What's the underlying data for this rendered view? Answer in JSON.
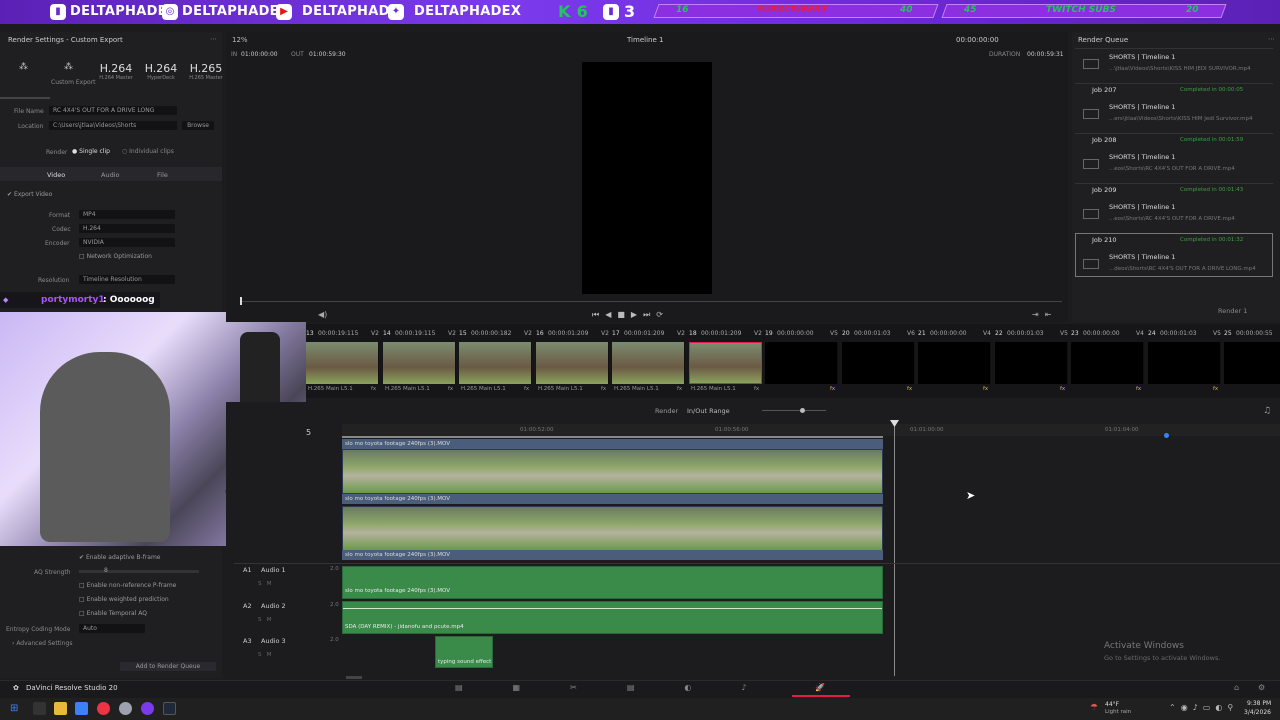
{
  "banner": {
    "handles": [
      "DELTAPHADE",
      "DELTAPHADE",
      "DELTAPHADE",
      "DELTAPHADEX"
    ],
    "k_label": "K 6",
    "k_count": "3",
    "subs_current": "16",
    "subs_label": "SUBSCRIBERS",
    "subs_goal": "40",
    "twitch_current": "45",
    "twitch_label": "TWITCH SUBS",
    "twitch_goal": "20",
    "colors": {
      "accent": "#7c3aed",
      "green": "#22c55e"
    }
  },
  "render_settings": {
    "title": "Render Settings - Custom Export",
    "presets": [
      {
        "name": "",
        "sub": "Custom Export"
      },
      {
        "name": "H.264",
        "sub": "H.264 Master"
      },
      {
        "name": "H.264",
        "sub": "HyperDeck"
      },
      {
        "name": "H.265",
        "sub": "H.265 Master"
      }
    ],
    "file_name_label": "File Name",
    "file_name": "RC 4X4'S OUT FOR A DRIVE LONG",
    "location_label": "Location",
    "location": "C:\\Users\\jtlaa\\Videos\\Shorts",
    "browse": "Browse",
    "render_label": "Render",
    "single_clip": "Single clip",
    "individual_clips": "Individual clips",
    "tabs": [
      "Video",
      "Audio",
      "File"
    ],
    "export_video": "Export Video",
    "format_label": "Format",
    "format": "MP4",
    "codec_label": "Codec",
    "codec": "H.264",
    "encoder_label": "Encoder",
    "encoder": "NVIDIA",
    "network_opt": "Network Optimization",
    "resolution_label": "Resolution",
    "resolution": "Timeline Resolution",
    "adaptive_bframe": "Enable adaptive B-frame",
    "aq_label": "AQ Strength",
    "aq_value": "8",
    "nonref_pframe": "Enable non-reference P-frame",
    "weighted_pred": "Enable weighted prediction",
    "temporal_aq": "Enable Temporal AQ",
    "entropy_label": "Entropy Coding Mode",
    "entropy_value": "Auto",
    "advanced": "Advanced Settings",
    "add_queue": "Add to Render Queue"
  },
  "chat": {
    "user": "portymorty1",
    "message": ": Oooooog"
  },
  "viewer": {
    "zoom": "12%",
    "timeline": "Timeline 1",
    "timecode": "00:00:00:00",
    "in_label": "IN",
    "in_tc": "01:00:00:00",
    "out_label": "OUT",
    "out_tc": "01:00:59:30",
    "duration_label": "DURATION",
    "duration_tc": "00:00:59:31"
  },
  "render_queue": {
    "title": "Render Queue",
    "jobs": [
      {
        "id": "",
        "name": "SHORTS | Timeline 1",
        "path": "...\\jtlaa\\Videos\\Shorts\\KISS HIM JEDI SURVIVOR.mp4",
        "status": ""
      },
      {
        "id": "Job 207",
        "name": "SHORTS | Timeline 1",
        "path": "...ers\\jtlaa\\Videos\\Shorts\\KISS HIM Jedi Survivor.mp4",
        "status": "Completed in 00:00:05"
      },
      {
        "id": "Job 208",
        "name": "SHORTS | Timeline 1",
        "path": "...eos\\Shorts\\RC 4X4'S OUT FOR A DRIVE.mp4",
        "status": "Completed in 00:01:59"
      },
      {
        "id": "Job 209",
        "name": "SHORTS | Timeline 1",
        "path": "...eos\\Shorts\\RC 4X4'S OUT FOR A DRIVE.mp4",
        "status": "Completed in 00:01:43"
      },
      {
        "id": "Job 210",
        "name": "SHORTS | Timeline 1",
        "path": "...deos\\Shorts\\RC 4X4'S OUT FOR A DRIVE LONG.mp4",
        "status": "Completed in 00:01:32"
      }
    ],
    "render_button": "Render 1"
  },
  "clips": [
    {
      "num": "13",
      "tc": "00:00:19:115",
      "track": "V2",
      "label": "H.265 Main L5.1"
    },
    {
      "num": "14",
      "tc": "00:00:19:115",
      "track": "V2",
      "label": "H.265 Main L5.1"
    },
    {
      "num": "15",
      "tc": "00:00:00:182",
      "track": "V2",
      "label": "H.265 Main L5.1"
    },
    {
      "num": "16",
      "tc": "00:00:01:209",
      "track": "V2",
      "label": "H.265 Main L5.1"
    },
    {
      "num": "17",
      "tc": "00:00:01:209",
      "track": "V2",
      "label": "H.265 Main L5.1"
    },
    {
      "num": "18",
      "tc": "00:00:01:209",
      "track": "V2",
      "label": "H.265 Main L5.1"
    },
    {
      "num": "19",
      "tc": "00:00:00:00",
      "track": "V5",
      "label": ""
    },
    {
      "num": "20",
      "tc": "00:00:01:03",
      "track": "V6",
      "label": ""
    },
    {
      "num": "21",
      "tc": "00:00:00:00",
      "track": "V4",
      "label": ""
    },
    {
      "num": "22",
      "tc": "00:00:01:03",
      "track": "V5",
      "label": ""
    },
    {
      "num": "23",
      "tc": "00:00:00:00",
      "track": "V4",
      "label": ""
    },
    {
      "num": "24",
      "tc": "00:00:01:03",
      "track": "V5",
      "label": ""
    },
    {
      "num": "25",
      "tc": "00:00:00:55",
      "track": "",
      "label": ""
    }
  ],
  "timeline": {
    "render_label": "Render",
    "render_range": "In/Out Range",
    "ruler": [
      "01:00:52:00",
      "01:00:56:00",
      "01:01:00:00",
      "01:01:04:00"
    ],
    "track_number": "5",
    "video_clip": "slo mo toyota footage 240fps (3).MOV",
    "audio_tracks": [
      {
        "id": "A1",
        "name": "Audio 1",
        "level": "2.0",
        "clip": "slo mo toyota footage 240fps (3).MOV"
      },
      {
        "id": "A2",
        "name": "Audio 2",
        "level": "2.0",
        "clip": "SDA (DAY REMIX) - jidanofu and pcute.mp4"
      },
      {
        "id": "A3",
        "name": "Audio 3",
        "level": "2.0",
        "clip": "typing sound effect ..."
      }
    ]
  },
  "watermark": {
    "line1": "Activate Windows",
    "line2": "Go to Settings to activate Windows."
  },
  "bottombar": {
    "app": "DaVinci Resolve Studio 20"
  },
  "taskbar": {
    "weather_temp": "44°F",
    "weather_desc": "Light rain",
    "time": "9:38 PM",
    "date": "3/4/2026"
  }
}
